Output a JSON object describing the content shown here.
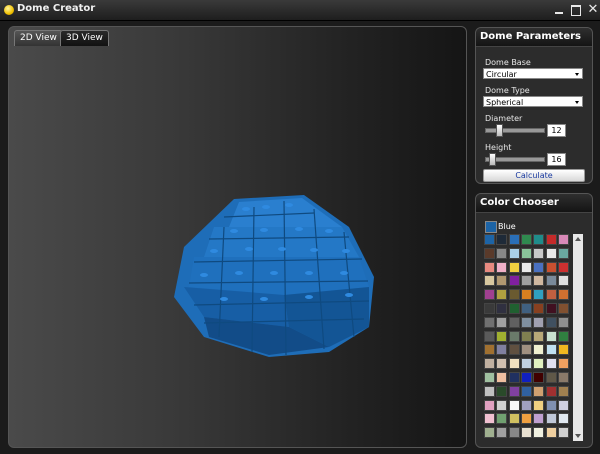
{
  "window": {
    "title": "Dome Creator"
  },
  "tabs": [
    {
      "label": "2D View"
    },
    {
      "label": "3D View"
    }
  ],
  "dome_parameters": {
    "header": "Dome Parameters",
    "base_label": "Dome Base",
    "base_value": "Circular",
    "type_label": "Dome Type",
    "type_value": "Spherical",
    "diameter_label": "Diameter",
    "diameter_value": "12",
    "height_label": "Height",
    "height_value": "16",
    "calculate_label": "Calculate"
  },
  "color_chooser": {
    "header": "Color Chooser",
    "selected_name": "Blue",
    "selected_color": "#1d64a6",
    "swatches": [
      "#1d64a6",
      "#1e2a38",
      "#2a6fb8",
      "#2f8a4f",
      "#1f8c8a",
      "#c42a2a",
      "#d889b8",
      "#5a3a2a",
      "#888888",
      "#aad0e8",
      "#8ac49a",
      "#c8c8c8",
      "#e8e8e8",
      "#6aa8a0",
      "#e88a80",
      "#f0b0c8",
      "#f0d040",
      "#eaeaea",
      "#4a70c0",
      "#c85030",
      "#cc3030",
      "#d8c8a0",
      "#b09870",
      "#8020a0",
      "#a0a0a0",
      "#d0b8a0",
      "#7a8a9a",
      "#e0e0e0",
      "#a04090",
      "#b0a040",
      "#6a5a30",
      "#d88020",
      "#30a0c0",
      "#c06040",
      "#d07030",
      "#3a3a3a",
      "#303040",
      "#206030",
      "#406080",
      "#884020",
      "#401020",
      "#805030",
      "#707070",
      "#a0a0a0",
      "#606060",
      "#8090a0",
      "#a0a0b0",
      "#405060",
      "#909090",
      "#5a5a5a",
      "#a0b030",
      "#6a7a6a",
      "#808050",
      "#b8a878",
      "#c8e0d0",
      "#308040",
      "#a07030",
      "#8080a0",
      "#605040",
      "#a09080",
      "#f0f0d0",
      "#c0e0f0",
      "#f0b820",
      "#c0b0a0",
      "#d0c0b0",
      "#f0e0c0",
      "#c0d0e0",
      "#e0f0c0",
      "#e0e0f0",
      "#f0a060",
      "#a0c0a0",
      "#f0c0a0",
      "#203060",
      "#1020c0",
      "#400000",
      "#605848",
      "#8a7a6a",
      "#c0c0c0",
      "#2a4a2a",
      "#8040a0",
      "#3060a0",
      "#d0a070",
      "#a03030",
      "#a08050",
      "#e0a0c0",
      "#d0d0d0",
      "#f8f8f8",
      "#a0a0c0",
      "#f0d080",
      "#8090b0",
      "#d0d0e0",
      "#f0c0d0",
      "#70a070",
      "#d0c060",
      "#f0a040",
      "#c0a0d0",
      "#c0c8d8",
      "#e0e8f0",
      "#a0b090",
      "#a0a0a0",
      "#888888",
      "#e8e0d0",
      "#f0f0e0",
      "#f0d0a0",
      "#d0d0d0"
    ]
  }
}
